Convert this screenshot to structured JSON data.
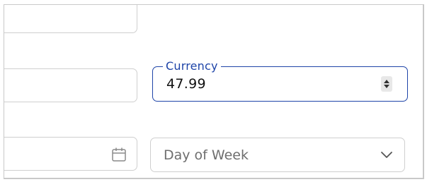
{
  "currency_field": {
    "label": "Currency",
    "value": "47.99"
  },
  "date_field": {
    "icon": "calendar-icon"
  },
  "day_of_week_select": {
    "placeholder": "Day of Week",
    "icon": "chevron-down-icon"
  },
  "colors": {
    "focus_accent": "#1e44a8",
    "border": "#cfcfcf",
    "placeholder": "#6e6e6e"
  }
}
